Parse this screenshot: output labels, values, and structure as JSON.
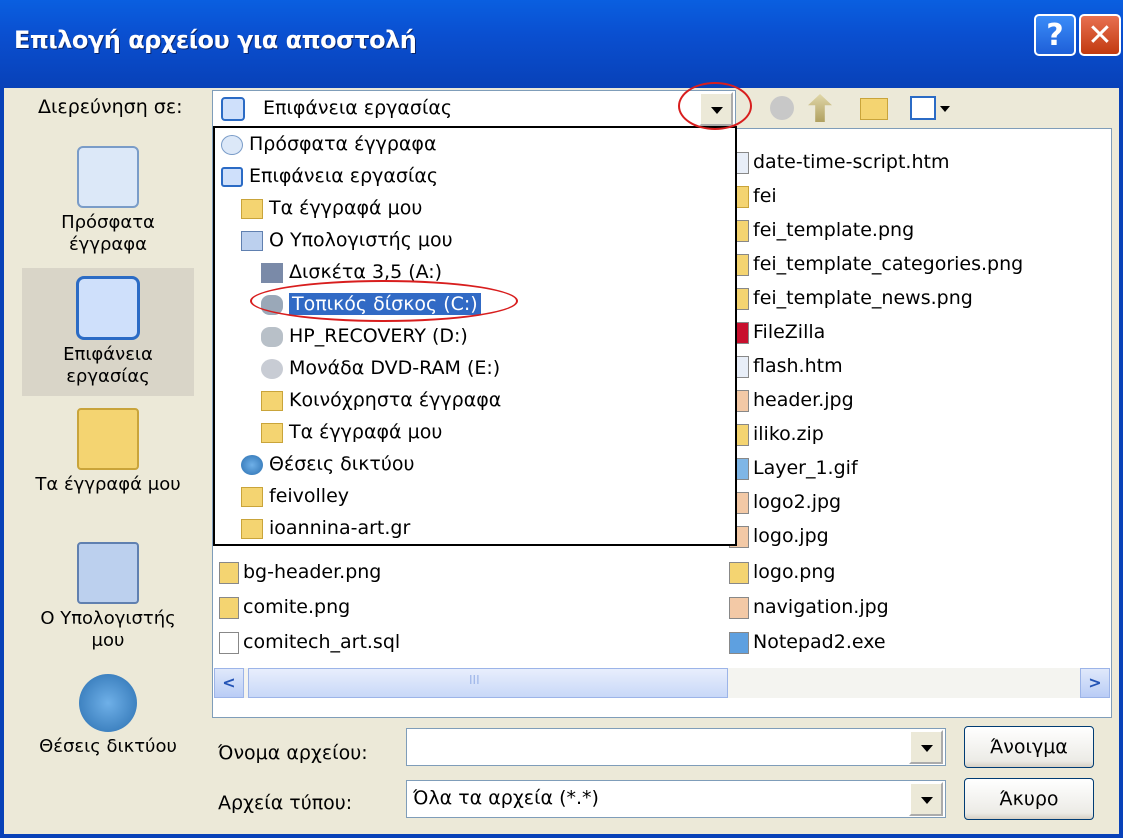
{
  "window": {
    "title": "Επιλογή αρχείου για αποστολή",
    "help_label": "?",
    "close_label": "✕"
  },
  "lookin": {
    "label": "Διερεύνηση σε:",
    "value": "Επιφάνεια εργασίας"
  },
  "places": [
    {
      "label": "Πρόσφατα έγγραφα",
      "icon": "recent-docs-icon"
    },
    {
      "label": "Επιφάνεια εργασίας",
      "icon": "desktop-icon"
    },
    {
      "label": "Τα έγγραφά μου",
      "icon": "my-documents-icon"
    },
    {
      "label": "Ο Υπολογιστής μου",
      "icon": "my-computer-icon"
    },
    {
      "label": "Θέσεις δικτύου",
      "icon": "network-places-icon"
    }
  ],
  "dropdown_items": [
    {
      "label": "Πρόσφατα έγγραφα",
      "icon": "recent-docs-icon"
    },
    {
      "label": "Επιφάνεια εργασίας",
      "icon": "desktop-icon"
    },
    {
      "label": "Τα έγγραφά μου",
      "icon": "my-documents-icon"
    },
    {
      "label": "Ο Υπολογιστής μου",
      "icon": "my-computer-icon"
    },
    {
      "label": "Δισκέτα 3,5 (A:)",
      "icon": "floppy-icon"
    },
    {
      "label": "Τοπικός δίσκος (C:)",
      "icon": "hard-drive-icon",
      "selected": true
    },
    {
      "label": "HP_RECOVERY (D:)",
      "icon": "hard-drive-icon"
    },
    {
      "label": "Μονάδα DVD-RAM (E:)",
      "icon": "dvd-drive-icon"
    },
    {
      "label": "Κοινόχρηστα έγγραφα",
      "icon": "folder-icon"
    },
    {
      "label": "Τα έγγραφά μου",
      "icon": "folder-icon"
    },
    {
      "label": "Θέσεις δικτύου",
      "icon": "network-places-icon"
    },
    {
      "label": "feivolley",
      "icon": "folder-icon"
    },
    {
      "label": "ioannina-art.gr",
      "icon": "folder-icon"
    }
  ],
  "files_left": [
    {
      "name": "bg-header.png",
      "icon": "fireworks-png-icon"
    },
    {
      "name": "comite.png",
      "icon": "fireworks-png-icon"
    },
    {
      "name": "comitech_art.sql",
      "icon": "text-file-icon"
    }
  ],
  "files_right": [
    {
      "name": "date-time-script.htm",
      "icon": "html-file-icon"
    },
    {
      "name": "fei",
      "icon": "folder-icon"
    },
    {
      "name": "fei_template.png",
      "icon": "fireworks-png-icon"
    },
    {
      "name": "fei_template_categories.png",
      "icon": "fireworks-png-icon"
    },
    {
      "name": "fei_template_news.png",
      "icon": "fireworks-png-icon"
    },
    {
      "name": "FileZilla",
      "icon": "filezilla-icon"
    },
    {
      "name": "flash.htm",
      "icon": "html-file-icon"
    },
    {
      "name": "header.jpg",
      "icon": "jpg-file-icon"
    },
    {
      "name": "iliko.zip",
      "icon": "zip-file-icon"
    },
    {
      "name": "Layer_1.gif",
      "icon": "gif-file-icon"
    },
    {
      "name": "logo2.jpg",
      "icon": "jpg-file-icon"
    },
    {
      "name": "logo.jpg",
      "icon": "jpg-file-icon"
    },
    {
      "name": "logo.png",
      "icon": "fireworks-png-icon"
    },
    {
      "name": "navigation.jpg",
      "icon": "jpg-file-icon"
    },
    {
      "name": "Notepad2.exe",
      "icon": "exe-file-icon"
    }
  ],
  "filename": {
    "label": "Όνομα αρχείου:",
    "value": ""
  },
  "filetype": {
    "label": "Αρχεία τύπου:",
    "value": "Όλα τα αρχεία (*.*)"
  },
  "buttons": {
    "open": "Άνοιγμα",
    "cancel": "Άκυρο"
  },
  "scrollbar": {
    "left_arrow": "<",
    "right_arrow": ">",
    "thumb_grip": "III"
  }
}
